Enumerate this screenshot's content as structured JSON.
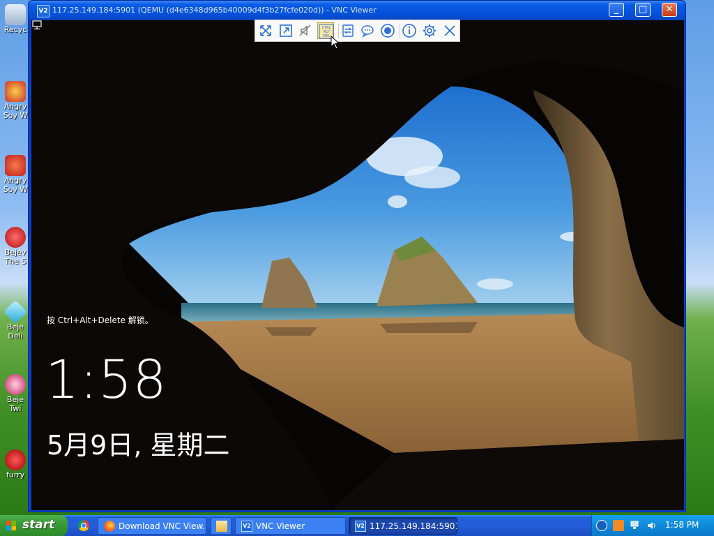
{
  "desktop": {
    "icons": [
      {
        "label": "Recyc"
      },
      {
        "label": "Angry\nSoy W"
      },
      {
        "label": "Angry\nSoy W"
      },
      {
        "label": "Bejev\nThe S"
      },
      {
        "label": "Beje\nDeli"
      },
      {
        "label": "Beje\nTwi"
      },
      {
        "label": "furry"
      }
    ]
  },
  "window": {
    "title": "117.25.149.184:5901 (QEMU (d4e6348d965b40009d4f3b27fcfe020d)) - VNC Viewer",
    "app_icon_text": "V2",
    "minimize": "_",
    "maximize": "□",
    "close": "✕"
  },
  "vnc_toolbar": {
    "buttons": [
      {
        "icon": "fullscreen-icon"
      },
      {
        "icon": "scale-icon"
      },
      {
        "icon": "mute-icon"
      },
      {
        "icon": "ctrl-alt-del-icon",
        "text": [
          "CTRL",
          "ALT",
          "DEL"
        ],
        "selected": true
      },
      {
        "icon": "transfer-icon"
      },
      {
        "icon": "chat-icon"
      },
      {
        "icon": "record-icon"
      },
      {
        "icon": "info-icon"
      },
      {
        "icon": "gear-icon"
      },
      {
        "icon": "close-icon"
      }
    ]
  },
  "lockscreen": {
    "hint": "按 Ctrl+Alt+Delete 解锁。",
    "time": "1:58",
    "date": "5月9日, 星期二"
  },
  "taskbar": {
    "start": "start",
    "tasks": [
      {
        "label": "Download VNC View..."
      },
      {
        "label": ""
      },
      {
        "label": "VNC Viewer"
      },
      {
        "label": "117.25.149.184:5901..."
      }
    ],
    "clock": "1:58 PM"
  },
  "colors": {
    "xp_blue": "#245edb",
    "start_green": "#3a9a37",
    "tray_blue": "#0f8ad9",
    "close_red": "#c63b14"
  }
}
